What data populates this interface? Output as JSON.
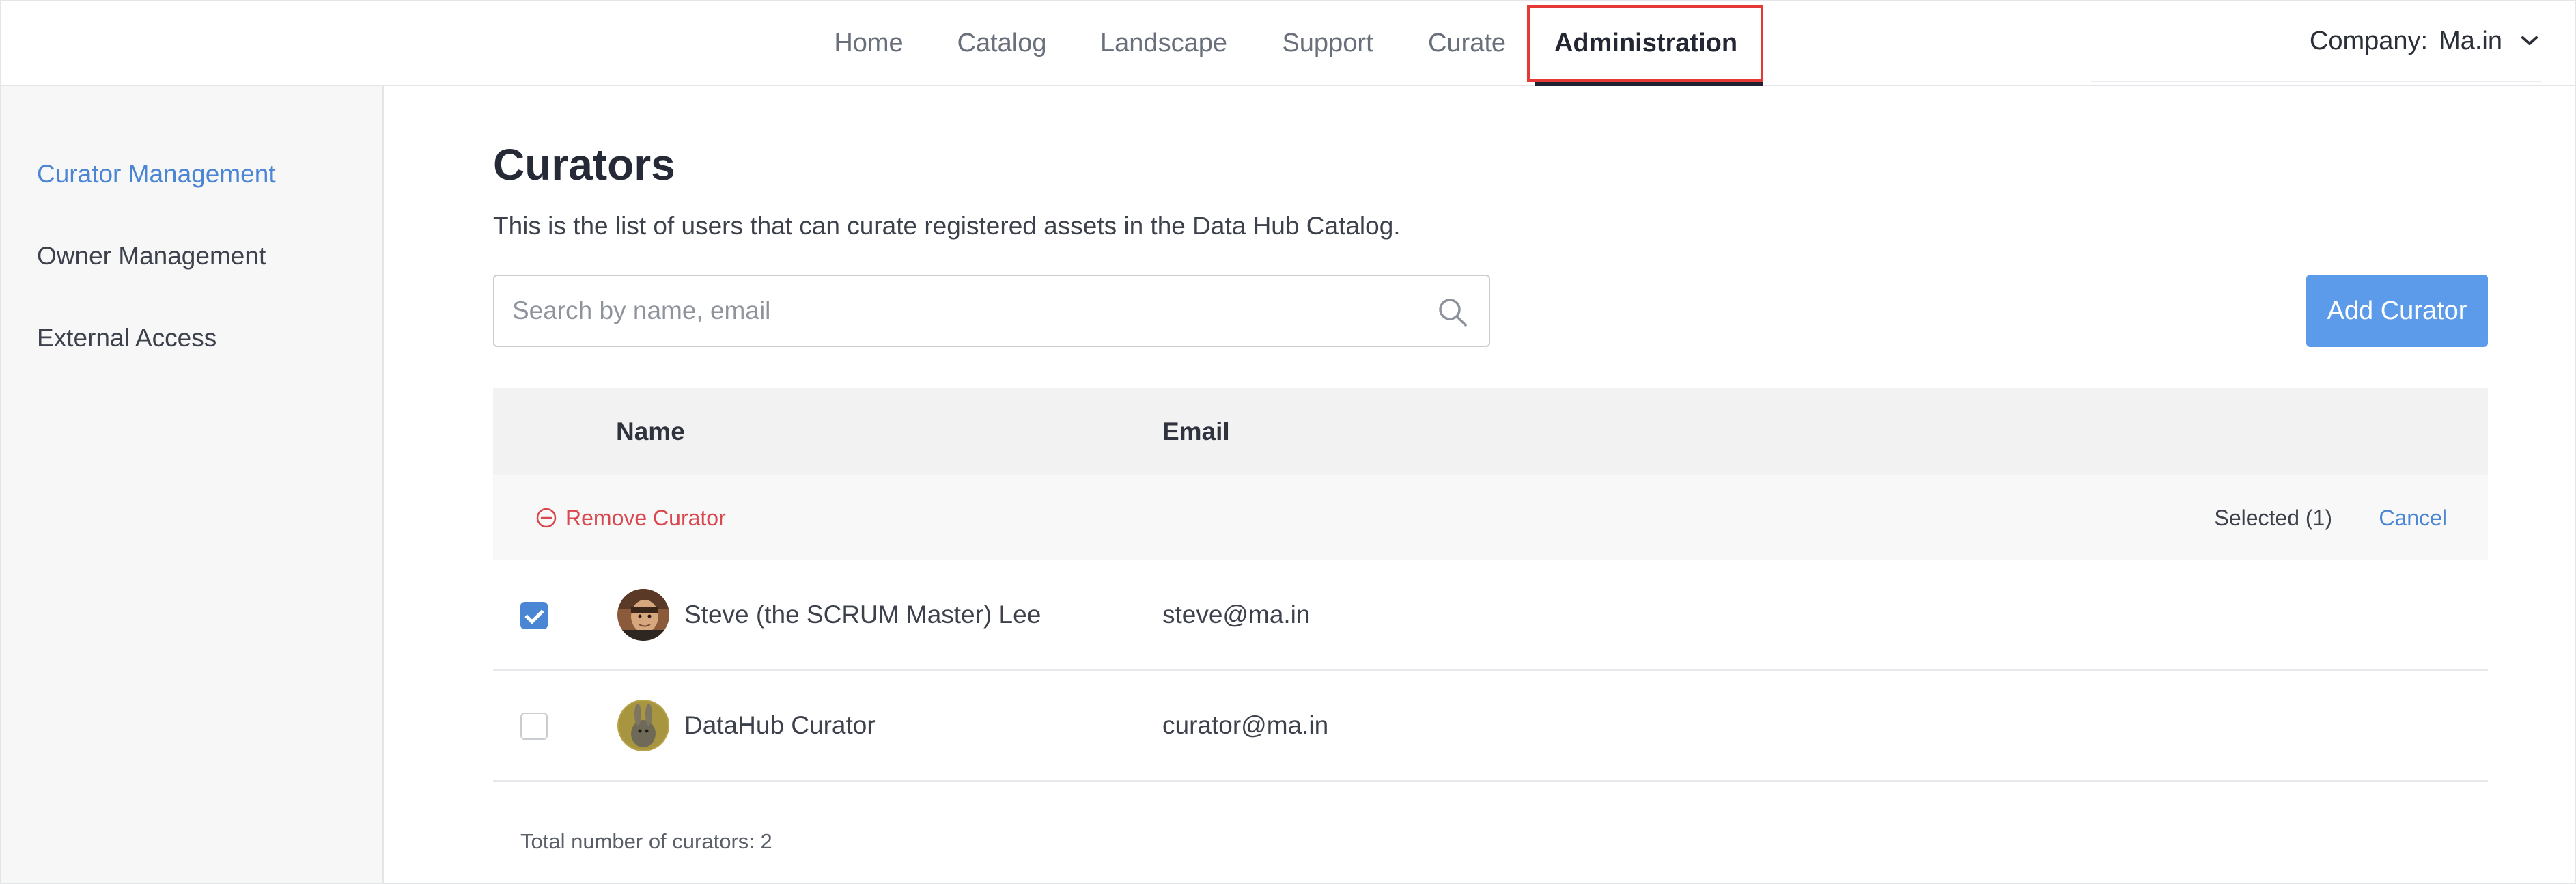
{
  "nav": {
    "tabs": [
      {
        "label": "Home",
        "active": false
      },
      {
        "label": "Catalog",
        "active": false
      },
      {
        "label": "Landscape",
        "active": false
      },
      {
        "label": "Support",
        "active": false
      },
      {
        "label": "Curate",
        "active": false
      },
      {
        "label": "Administration",
        "active": true
      }
    ],
    "company_label": "Company:",
    "company_value": "Ma.in",
    "company_icon": "chevron-down-icon"
  },
  "sidebar": {
    "items": [
      {
        "label": "Curator Management",
        "active": true
      },
      {
        "label": "Owner Management",
        "active": false
      },
      {
        "label": "External Access",
        "active": false
      }
    ]
  },
  "main": {
    "title": "Curators",
    "description": "This is the list of users that can curate registered assets in the Data Hub Catalog.",
    "search": {
      "placeholder": "Search by name, email",
      "value": "",
      "icon": "search-icon"
    },
    "add_button": "Add Curator"
  },
  "table": {
    "columns": [
      "Name",
      "Email"
    ],
    "actions": {
      "remove_label": "Remove Curator",
      "selected_text": "Selected (1)",
      "cancel_label": "Cancel"
    },
    "rows": [
      {
        "name": "Steve (the SCRUM Master) Lee",
        "email": "steve@ma.in",
        "checked": true
      },
      {
        "name": "DataHub Curator",
        "email": "curator@ma.in",
        "checked": false
      }
    ],
    "total_text": "Total number of curators: 2"
  },
  "colors": {
    "accent": "#4a86d4",
    "button": "#5b9bea",
    "danger": "#d9484e",
    "highlight": "#e53935"
  }
}
